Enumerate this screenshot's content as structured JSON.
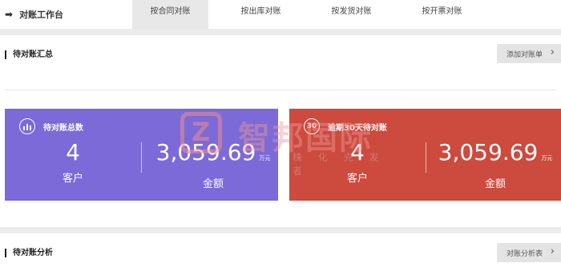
{
  "nav": {
    "brand": "对账工作台",
    "tabs": [
      "按合同对账",
      "按出库对账",
      "按发货对账",
      "按开票对账"
    ],
    "active_tab": 0
  },
  "pending_summary": {
    "title": "待对账汇总",
    "button": "添加对账单"
  },
  "cards": {
    "total": {
      "icon": "bar-chart-icon",
      "title": "待对账总数",
      "customers": "4",
      "customers_label": "客户",
      "amount": "3,059.69",
      "amount_unit": "万元",
      "amount_label": "金额"
    },
    "overdue": {
      "icon_text": "30",
      "title": "逾期30天待对账",
      "customers": "4",
      "customers_label": "客户",
      "amount": "3,059.69",
      "amount_unit": "万元",
      "amount_label": "金额"
    }
  },
  "analysis": {
    "title": "待对账分析",
    "button": "对账分析表"
  },
  "watermark": {
    "text": "智邦国际",
    "sub": "株 化 先 发 者"
  },
  "colors": {
    "purple_card": "#7b6ad8",
    "red_card": "#cc4a3e",
    "active_tab_bg": "#e8e8e8"
  }
}
